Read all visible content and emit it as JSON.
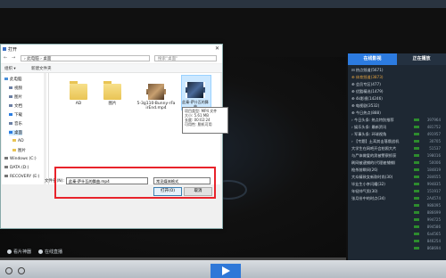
{
  "dialog": {
    "title": "打开",
    "close_glyph": "✕",
    "address": "› 此电脑 › 桌面",
    "search_placeholder": "搜索\"桌面\"",
    "toolbar": {
      "organize": "组织 ▾",
      "new_folder": "新建文件夹"
    },
    "nav_items": [
      {
        "label": "此电脑",
        "icon": "computer-icon"
      },
      {
        "label": "视频",
        "icon": "video-folder-icon"
      },
      {
        "label": "图片",
        "icon": "picture-folder-icon"
      },
      {
        "label": "文档",
        "icon": "document-folder-icon"
      },
      {
        "label": "下载",
        "icon": "download-folder-icon"
      },
      {
        "label": "音乐",
        "icon": "music-folder-icon"
      },
      {
        "label": "桌面",
        "icon": "desktop-folder-icon"
      },
      {
        "label": "AD",
        "icon": "folder-icon"
      },
      {
        "label": "图片",
        "icon": "folder-icon"
      },
      {
        "label": "Windows (C:)",
        "icon": "drive-icon"
      },
      {
        "label": "DATA (D:)",
        "icon": "drive-icon"
      },
      {
        "label": "RECOVERY (E:)",
        "icon": "drive-icon"
      }
    ],
    "files": [
      {
        "name": "AD",
        "kind": "folder"
      },
      {
        "name": "图片",
        "kind": "folder"
      },
      {
        "name": "5-3g110-Bunny-rFairEnd.mp4",
        "kind": "video"
      },
      {
        "name": "此秦-萨什瓦的舞曲",
        "kind": "video"
      }
    ],
    "tooltip": [
      "项目类型: MP4 文件",
      "大小: 5.61 MB",
      "长度: 00:02:24",
      "可用性: 脱机可用"
    ],
    "filename_label": "文件名(N):",
    "filename_value": "此秦-萨什瓦的舞曲.mp4",
    "filetype_value": "常见媒体格式",
    "open_label": "打开(O)",
    "cancel_label": "取消"
  },
  "panel": {
    "tabs": [
      "在线影视",
      "正在播放"
    ],
    "items": [
      {
        "label": "⊟ 热点频道(5671)",
        "num": ""
      },
      {
        "label": "⊕ 体育频道(3873)",
        "num": ""
      },
      {
        "label": "⊕ 会员专区(477)",
        "num": ""
      },
      {
        "label": "⊕ 优酷精选(1479)",
        "num": ""
      },
      {
        "label": "⊕ 4k影视(14246)",
        "num": ""
      },
      {
        "label": "⊕ 电视剧(3532)",
        "num": ""
      },
      {
        "label": "⊕ 今日热点(888)",
        "num": ""
      },
      {
        "label": "› 今日头条: 热点特别推荐",
        "num": "397964"
      },
      {
        "label": "› 娱乐头条: 最新资讯",
        "num": "481752"
      },
      {
        "label": "› 军事头条: 环球视角",
        "num": "491957"
      },
      {
        "label": "› 【专题】土耳其击落俄战机",
        "num": "30705"
      },
      {
        "label": "大学生在网吧开会拍照大片",
        "num": "51537"
      },
      {
        "label": "与尸体做爱的男被警察抓获",
        "num": "198016"
      },
      {
        "label": "刷网被逮捕的(代理被捕捕)",
        "num": "50006"
      },
      {
        "label": "枪杀前瞬间(26)",
        "num": "184819"
      },
      {
        "label": "大众精致女新款时尚(30)",
        "num": "284655"
      },
      {
        "label": "毕业生小李闪耀(32)",
        "num": "994835"
      },
      {
        "label": "年轻帅气男(30)",
        "num": "151917"
      },
      {
        "label": "张月份中的时点(34)",
        "num": "2A4574"
      },
      {
        "label": "",
        "num": "986095"
      },
      {
        "label": "",
        "num": "886699"
      },
      {
        "label": "",
        "num": "994725"
      },
      {
        "label": "",
        "num": "894586"
      },
      {
        "label": "",
        "num": "6a4565"
      },
      {
        "label": "",
        "num": "846254"
      },
      {
        "label": "",
        "num": "868694"
      }
    ]
  },
  "bottom_links": [
    "看片神器",
    "在线直播"
  ],
  "colors": {
    "accent": "#2c7be0",
    "highlight": "#e8232b"
  }
}
